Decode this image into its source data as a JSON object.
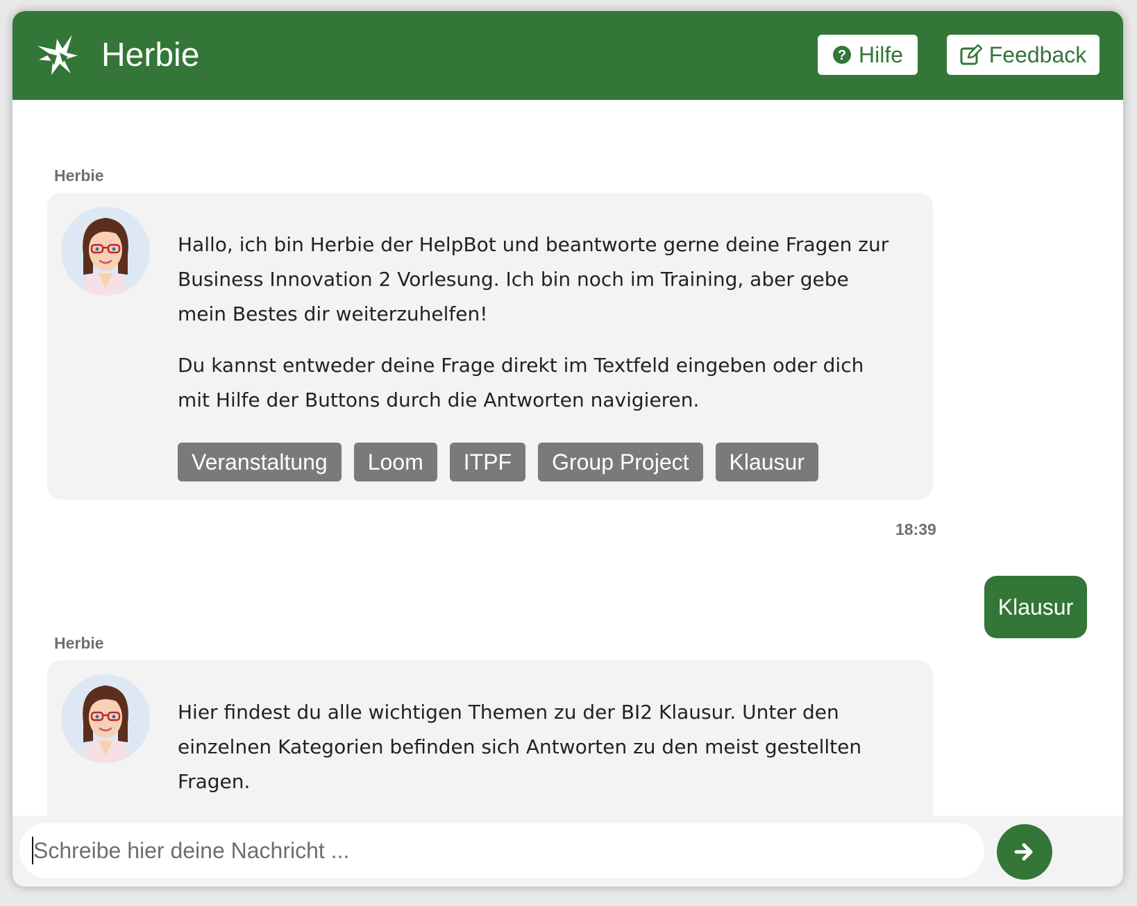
{
  "header": {
    "title": "Herbie",
    "logo_icon": "herbie-logo-icon",
    "help_label": "Hilfe",
    "feedback_label": "Feedback"
  },
  "colors": {
    "brand_green": "#337638",
    "bubble_bg": "#f3f3f3",
    "quick_reply_bg": "#7a7a7a"
  },
  "messages": [
    {
      "sender": "Herbie",
      "paragraphs": [
        "Hallo, ich bin Herbie der HelpBot und beantworte gerne deine Fragen zur Business Innovation 2 Vorlesung. Ich bin noch im Training, aber gebe mein Bestes dir weiterzuhelfen!",
        "Du kannst entweder deine Frage direkt im Textfeld eingeben oder dich mit Hilfe der Buttons durch die Antworten navigieren."
      ],
      "quick_replies": [
        "Veranstaltung",
        "Loom",
        "ITPF",
        "Group Project",
        "Klausur"
      ],
      "time": "18:39"
    },
    {
      "sender": "user",
      "text": "Klausur"
    },
    {
      "sender": "Herbie",
      "paragraphs": [
        "Hier findest du alle wichtigen Themen zu der BI2 Klausur. Unter den einzelnen Kategorien befinden sich Antworten zu den meist gestellten Fragen."
      ]
    }
  ],
  "composer": {
    "placeholder": "Schreibe hier deine Nachricht ...",
    "value": "",
    "send_icon": "arrow-right-icon"
  }
}
